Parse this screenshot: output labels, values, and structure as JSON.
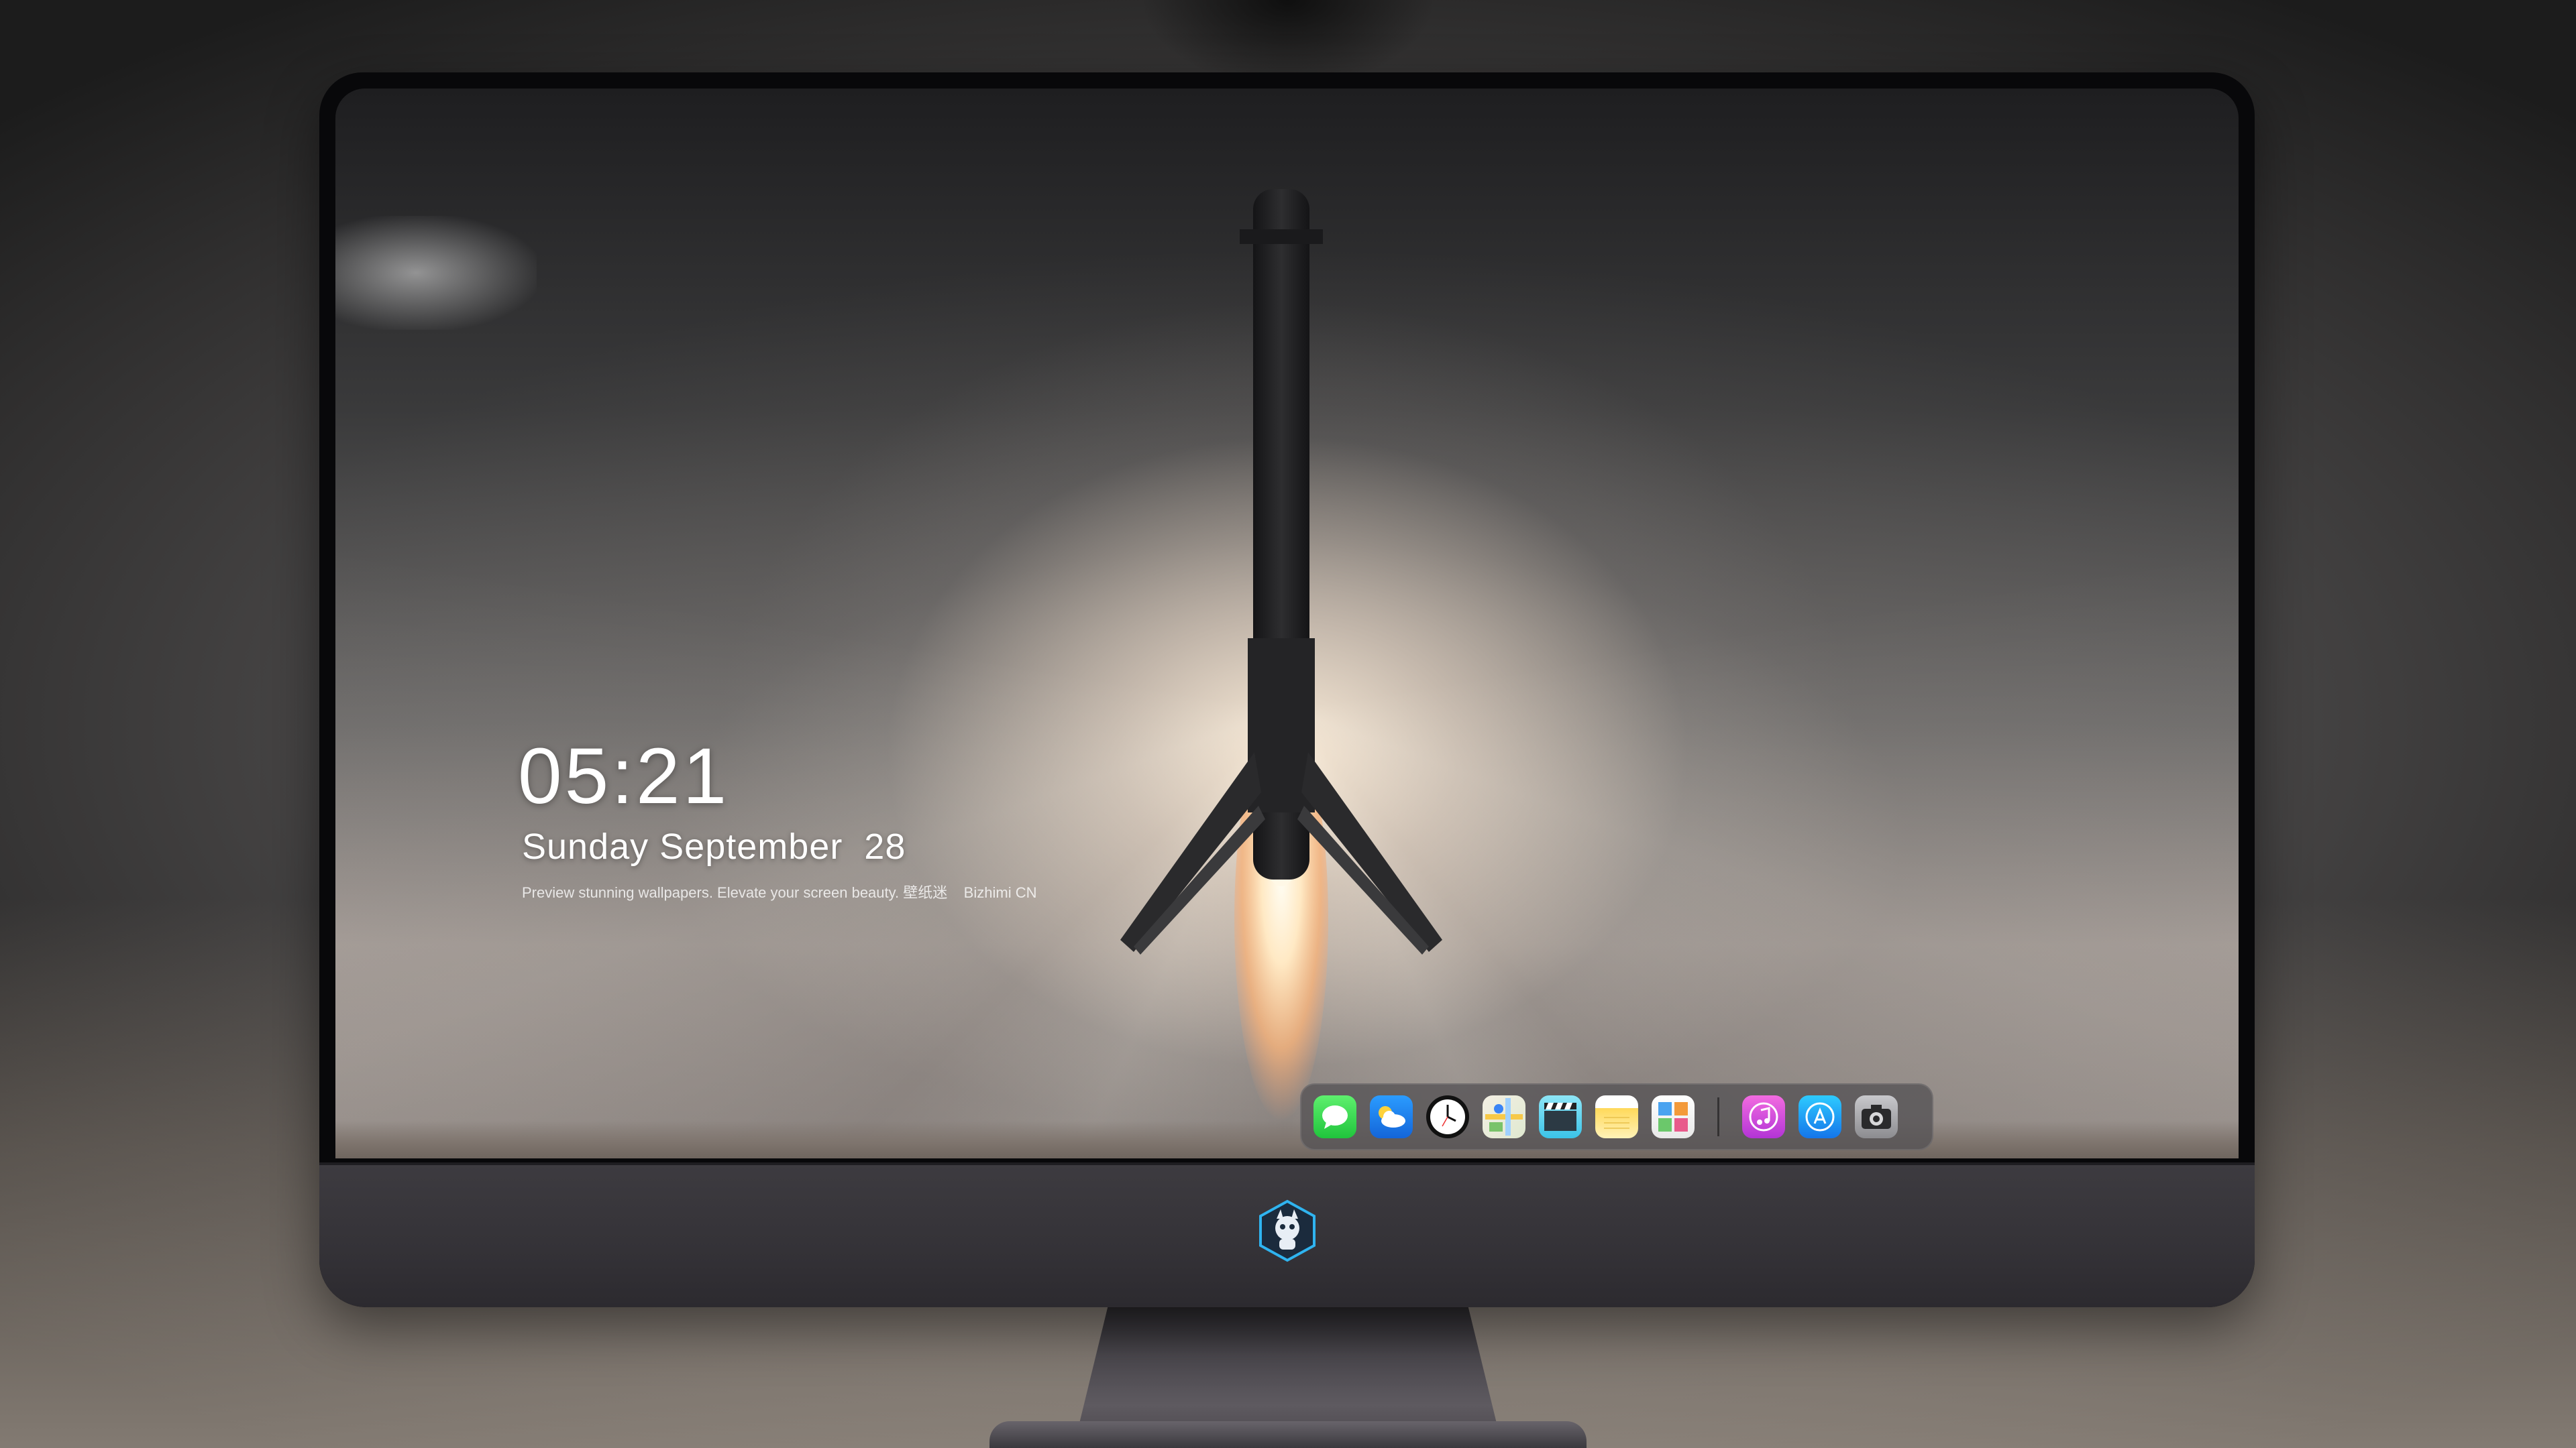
{
  "lockscreen": {
    "time": "05:21",
    "date": "Sunday September  28",
    "tagline": "Preview stunning wallpapers. Elevate your screen beauty. 壁纸迷    Bizhimi CN"
  },
  "dock": {
    "apps": [
      {
        "name": "messages-icon",
        "color": "#2fd14a"
      },
      {
        "name": "weather-icon",
        "color": "#1f7fee"
      },
      {
        "name": "clock-icon",
        "color": "#111111"
      },
      {
        "name": "maps-icon",
        "color": "#e9ecd8"
      },
      {
        "name": "video-icon",
        "color": "#5ad1ef"
      },
      {
        "name": "notes-icon",
        "color": "#ffd95a"
      },
      {
        "name": "calendar-icon",
        "color": "#eeeeee"
      },
      {
        "name": "music-icon",
        "color": "#d24fe0"
      },
      {
        "name": "app-store-icon",
        "color": "#1e9bf5"
      },
      {
        "name": "camera-icon",
        "color": "#a6a6aa"
      }
    ]
  },
  "colors": {
    "bezel": "#08080a",
    "chin": "#38363b",
    "clock_text": "#ffffff"
  }
}
